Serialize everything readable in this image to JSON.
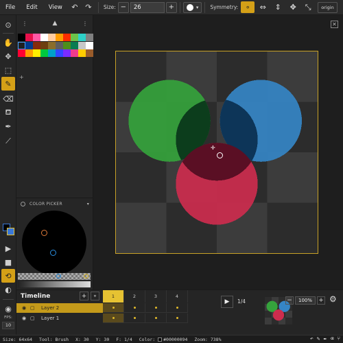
{
  "menu": [
    "File",
    "Edit",
    "View"
  ],
  "toolbar": {
    "size_label": "Size:",
    "size_value": "26",
    "symmetry_label": "Symmetry:",
    "origin_label": "origin"
  },
  "palette": {
    "colors": [
      "#000000",
      "#e8104b",
      "#ff59a6",
      "#ffffff",
      "#ffcca0",
      "#ff9d00",
      "#ff2d00",
      "#6cc44a",
      "#2ed0c8",
      "#808080",
      "#202020",
      "#003a8c",
      "#872a0d",
      "#6d3f10",
      "#8a6d2b",
      "#5e5e5e",
      "#4d8f1a",
      "#0a7c52",
      "#c7c7c7",
      "#ffffff",
      "#ff0033",
      "#ff9d00",
      "#ffef00",
      "#00c83f",
      "#00a0c8",
      "#3047ff",
      "#7a2cff",
      "#f03c8c",
      "#ffcc00",
      "#9a5c2b"
    ],
    "add_label": "+"
  },
  "color_picker": {
    "title": "COLOR PICKER",
    "primary": "#000000",
    "secondary": "#3a78d8"
  },
  "timeline": {
    "title": "Timeline",
    "layers": [
      {
        "name": "Layer 2",
        "active": true
      },
      {
        "name": "Layer 1",
        "active": false
      }
    ],
    "frames": [
      "1",
      "2",
      "3",
      "4"
    ],
    "current_frame": "1/4",
    "zoom": "100%"
  },
  "fps": {
    "label": "FPS:",
    "value": "10"
  },
  "status": {
    "size": "Size: 64x64",
    "tool": "Tool: Brush",
    "x": "X: 30",
    "y": "Y: 30",
    "frame": "F: 1/4",
    "color_label": "Color:",
    "color_hex": "#00000094",
    "zoom": "Zoom: 738%"
  },
  "canvas": {
    "circles": [
      {
        "name": "green",
        "color": "#3aa040"
      },
      {
        "name": "blue",
        "color": "#3a86c8"
      },
      {
        "name": "red",
        "color": "#c82c4c"
      }
    ]
  }
}
